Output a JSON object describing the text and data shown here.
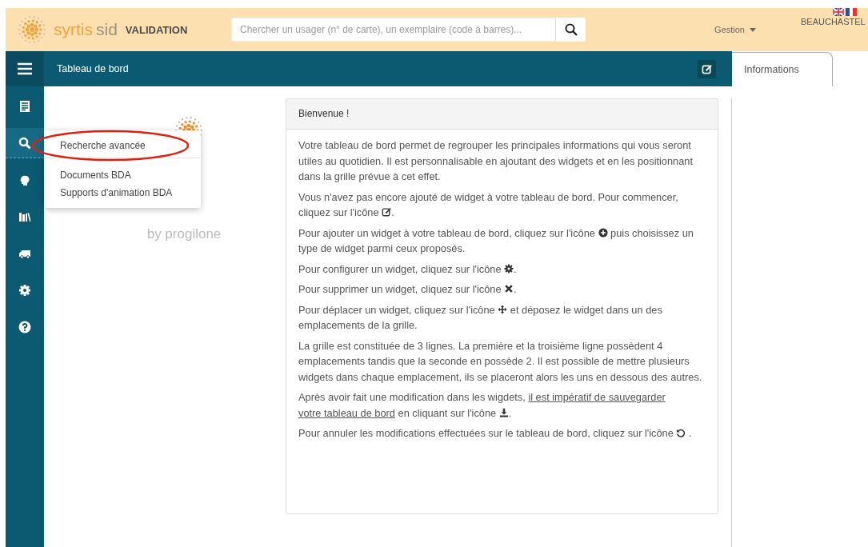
{
  "header": {
    "brand_main": "syrtis",
    "brand_sub": "sid",
    "brand_env": "VALIDATION",
    "search": {
      "placeholder": "Chercher un usager (n° de carte), un exemplaire (code à barres)..."
    },
    "menu": "Gestion",
    "user": "BEAUCHASTEL"
  },
  "navbar": {
    "title": "Tableau de bord"
  },
  "side_tab": {
    "label": "Informations",
    "selected": true
  },
  "sidebar": {
    "items": [
      {
        "kind": "documents",
        "selected": false
      },
      {
        "kind": "search",
        "selected": true
      },
      {
        "kind": "head",
        "selected": false
      },
      {
        "kind": "books",
        "selected": false
      },
      {
        "kind": "truck",
        "selected": false
      },
      {
        "kind": "gear",
        "selected": false
      },
      {
        "kind": "help",
        "selected": false
      }
    ]
  },
  "dropdown": {
    "groups": [
      [
        "Recherche avancée"
      ],
      [
        "Documents BDA",
        "Supports d'animation BDA"
      ]
    ]
  },
  "logo": {
    "tagline": "by progilone"
  },
  "card": {
    "title": "Bienvenue !",
    "paragraphs": [
      [
        {
          "kind": "text",
          "text": "Votre tableau de bord permet de regrouper les principales informations qui vous seront utiles au quotidien. Il est personnalisable en ajoutant des widgets et en les positionnant dans la grille prévue à cet effet."
        }
      ],
      [
        {
          "kind": "text",
          "text": "Vous n'avez pas encore ajouté de widget à votre tableau de bord. Pour commencer, cliquez sur l'icône "
        },
        {
          "kind": "edit"
        },
        {
          "kind": "text",
          "text": "."
        }
      ],
      [
        {
          "kind": "text",
          "text": "Pour ajouter un widget à votre tableau de bord, cliquez sur l'icône "
        },
        {
          "kind": "plus"
        },
        {
          "kind": "text",
          "text": " puis choisissez un type de widget parmi ceux proposés."
        }
      ],
      [
        {
          "kind": "text",
          "text": "Pour configurer un widget, cliquez sur l'icône "
        },
        {
          "kind": "gear"
        },
        {
          "kind": "text",
          "text": "."
        }
      ],
      [
        {
          "kind": "text",
          "text": "Pour supprimer un widget, cliquez sur l'icône "
        },
        {
          "kind": "cross"
        },
        {
          "kind": "text",
          "text": "."
        }
      ],
      [
        {
          "kind": "text",
          "text": "Pour déplacer un widget, cliquez sur l'icône "
        },
        {
          "kind": "move"
        },
        {
          "kind": "text",
          "text": " et déposez le widget dans un des emplacements de la grille."
        }
      ],
      [
        {
          "kind": "text",
          "text": "La grille est constituée de 3 lignes. La première et la troisième ligne possèdent 4 emplacements tandis que la seconde en possède 2. Il est possible de mettre plusieurs widgets dans chaque emplacement, ils se placeront alors les uns en dessous des autres."
        }
      ],
      [
        {
          "kind": "text",
          "text": "Après avoir fait une modification dans les wigdets, "
        },
        {
          "kind": "link",
          "text": "il est impératif de sauvegarder"
        },
        {
          "kind": "link",
          "text": "votre tableau de bord"
        },
        {
          "kind": "text",
          "text": " en cliquant sur l'icône "
        },
        {
          "kind": "download"
        },
        {
          "kind": "text",
          "text": "."
        }
      ],
      [
        {
          "kind": "text",
          "text": "Pour annuler les modifications effectuées sur le tableau de bord, cliquez sur l'icône "
        },
        {
          "kind": "undo"
        },
        {
          "kind": "text",
          "text": " ."
        }
      ]
    ]
  }
}
